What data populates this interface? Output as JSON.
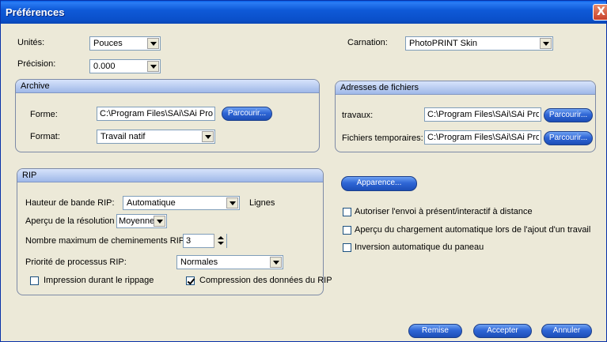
{
  "window": {
    "title": "Préférences",
    "close_glyph": "X"
  },
  "general": {
    "units_label": "Unités:",
    "units_value": "Pouces",
    "precision_label": "Précision:",
    "precision_value": "0.000",
    "carnation_label": "Carnation:",
    "carnation_value": "PhotoPRINT Skin"
  },
  "archive": {
    "title": "Archive",
    "forme_label": "Forme:",
    "forme_value": "C:\\Program Files\\SAi\\SAi Prod",
    "browse_label": "Parcourir...",
    "format_label": "Format:",
    "format_value": "Travail natif"
  },
  "addresses": {
    "title": "Adresses de fichiers",
    "travaux_label": "travaux:",
    "travaux_value": "C:\\Program Files\\SAi\\SAi Prod",
    "temp_label": "Fichiers temporaires:",
    "temp_value": "C:\\Program Files\\SAi\\SAi Prod",
    "browse_label": "Parcourir..."
  },
  "rip": {
    "title": "RIP",
    "band_label": "Hauteur de bande RIP:",
    "band_value": "Automatique",
    "band_unit": "Lignes",
    "resolution_label": "Aperçu de la résolution",
    "resolution_value": "Moyenne",
    "max_paths_label": "Nombre maximum de cheminements RIP:",
    "max_paths_value": "3",
    "priority_label": "Priorité de processus RIP:",
    "priority_value": "Normales",
    "print_while_rip_label": "Impression durant le rippage",
    "print_while_rip_checked": false,
    "compression_label": "Compression des données du RIP",
    "compression_checked": true
  },
  "appearance": {
    "button_label": "Apparence..."
  },
  "options": [
    {
      "label": "Autoriser l'envoi à présent/interactif à distance",
      "checked": false
    },
    {
      "label": "Aperçu du chargement automatique lors de l'ajout d'un travail",
      "checked": false
    },
    {
      "label": "Inversion automatique du paneau",
      "checked": false
    }
  ],
  "footer": {
    "reset_label": "Remise",
    "accept_label": "Accepter",
    "cancel_label": "Annuler"
  },
  "colors": {
    "title_bar": "#0a4fc9",
    "button_blue": "#2f66d6",
    "group_border": "#7d8aa6",
    "dialog_bg": "#ece9d8"
  }
}
